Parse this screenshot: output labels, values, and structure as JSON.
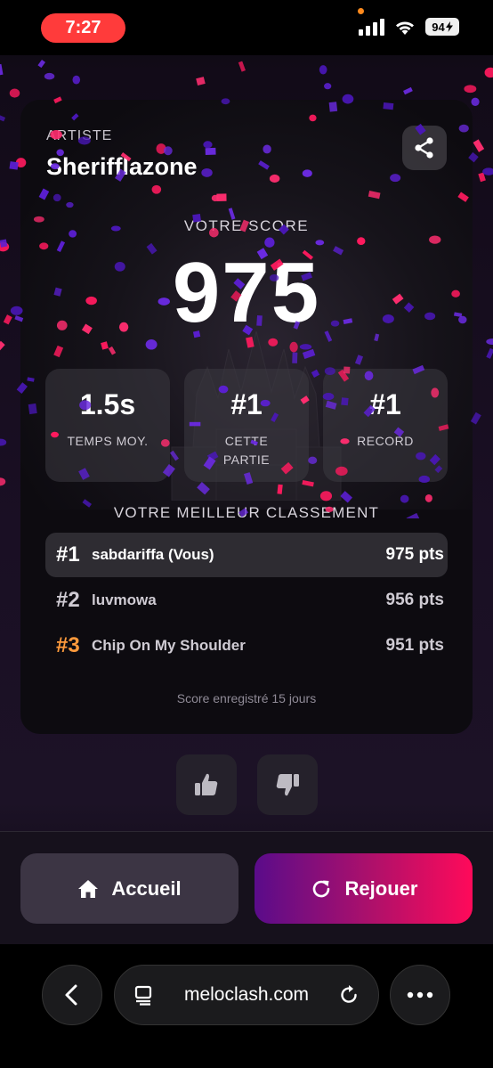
{
  "status_bar": {
    "time": "7:27",
    "battery": "94",
    "icons": [
      "signal-icon",
      "wifi-icon",
      "battery-icon"
    ]
  },
  "card": {
    "artist_label": "ARTISTE",
    "artist_name": "Sherifflazone",
    "share_icon": "share-icon",
    "score_label": "VOTRE SCORE",
    "score_value": "975",
    "stats": [
      {
        "value": "1.5s",
        "label": "TEMPS MOY."
      },
      {
        "value": "#1",
        "label": "CETTE PARTIE"
      },
      {
        "value": "#1",
        "label": "RECORD"
      }
    ],
    "best_label": "VOTRE MEILLEUR CLASSEMENT",
    "leaderboard": [
      {
        "rank": "#1",
        "name": "sabdariffa (Vous)",
        "points": "975 pts"
      },
      {
        "rank": "#2",
        "name": "luvmowa",
        "points": "956 pts"
      },
      {
        "rank": "#3",
        "name": "Chip On My Shoulder",
        "points": "951 pts"
      }
    ],
    "saved_note": "Score enregistré 15 jours"
  },
  "feedback": {
    "like_icon": "thumbs-up-icon",
    "dislike_icon": "thumbs-down-icon"
  },
  "actions": {
    "home_label": "Accueil",
    "replay_label": "Rejouer"
  },
  "browser": {
    "url": "meloclash.com",
    "icons": [
      "back-arrow-icon",
      "tabs-icon",
      "reload-icon",
      "more-icon"
    ]
  },
  "colors": {
    "accent_pink": "#ff0a5a",
    "accent_purple": "#5a0c8a",
    "rank3": "#ff9a3c",
    "time_pill": "#ff3b3b"
  }
}
